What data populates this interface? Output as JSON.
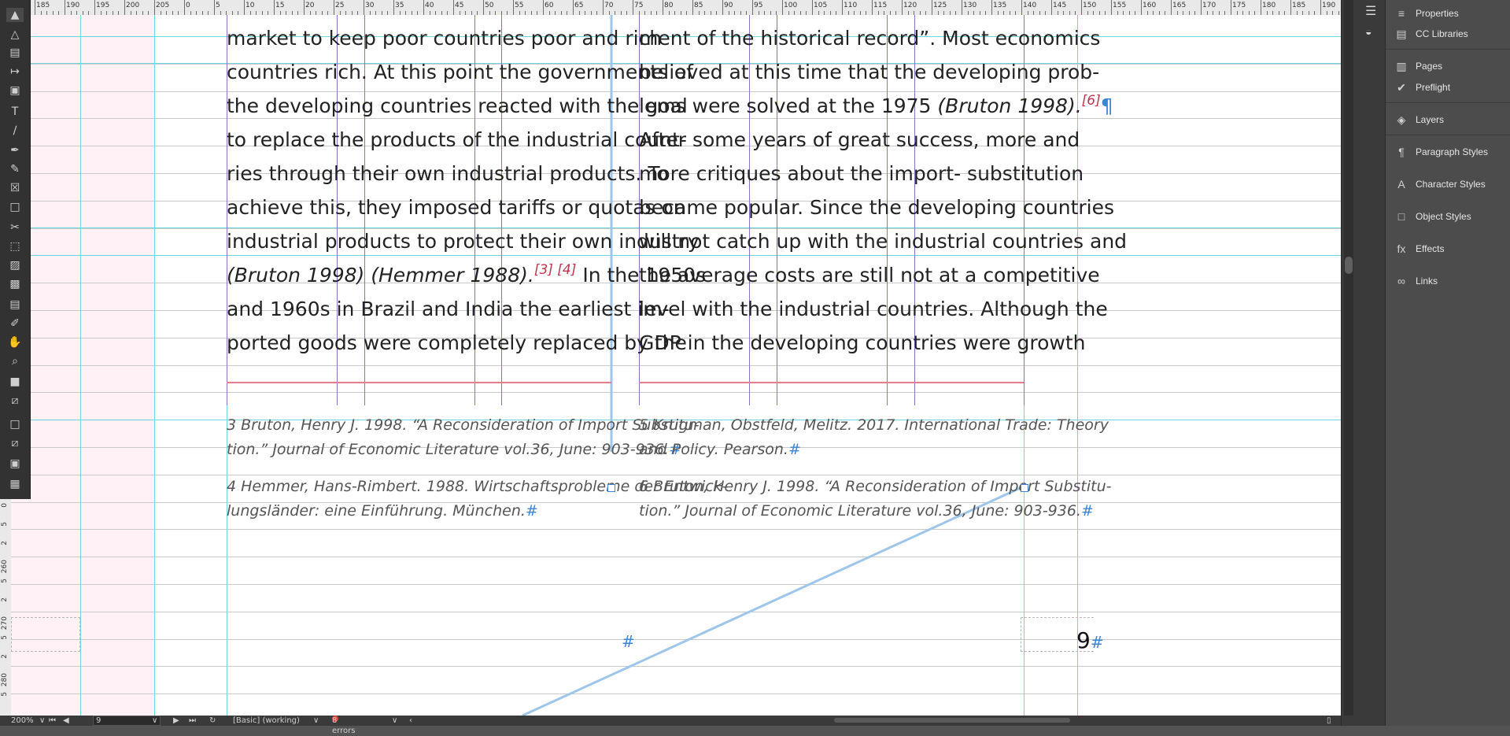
{
  "ruler": {
    "top_labels": [
      "185",
      "190",
      "195",
      "200",
      "205",
      "0",
      "5",
      "10",
      "15",
      "20",
      "25",
      "30",
      "35",
      "40",
      "45",
      "50",
      "55",
      "60",
      "65",
      "70",
      "75",
      "80",
      "85",
      "90",
      "95",
      "100",
      "105",
      "110",
      "115",
      "120",
      "125",
      "130",
      "135",
      "140",
      "145",
      "150",
      "155",
      "160",
      "165",
      "170",
      "175",
      "180",
      "185",
      "190"
    ],
    "left_labels": [
      "0",
      "5",
      "2",
      "260",
      "5",
      "2",
      "270",
      "5",
      "2",
      "280",
      "5"
    ]
  },
  "document": {
    "col1_lines": [
      "market to keep poor countries poor and rich",
      "countries rich. At this point the governments of",
      "the developing countries reacted with the goal",
      "to replace the products of the industrial count-",
      "ries through their own industrial products. To",
      "achieve this, they imposed tariffs or quotas on",
      "industrial products to protect their own industry"
    ],
    "col1_line8_a": "(Bruton 1998) (Hemmer 1988).",
    "col1_line8_ref": "[3] [4]",
    "col1_line8_b": " In the 1950s",
    "col1_line9": "and 1960s in Brazil and India the earliest im-",
    "col1_line10": "ported goods were completely replaced by the",
    "col2_line1": "ment of the historical record”. Most economics",
    "col2_line2": "believed at this time that the developing prob-",
    "col2_line3_a": "lems were solved at the 1975 ",
    "col2_line3_it": "(Bruton 1998).",
    "col2_line3_ref": "[6]",
    "col2_line3_pil": "¶",
    "col2_lines_rest": [
      "After some years of great success, more and",
      "more critiques about the import- substitution",
      "became popular. Since the developing countries",
      "will not catch up with the industrial countries and",
      "the average costs are still not at a competitive",
      "level with the industrial countries. Although the",
      "GDP in the developing countries were growth"
    ],
    "footnotes": {
      "fn3_l1": "3 Bruton, Henry J. 1998. “A Reconsideration of Import Substitu-",
      "fn3_l2": "tion.” Journal of Economic Literature vol.36, June: 903-936.",
      "fn4_l1": "4 Hemmer, Hans-Rimbert. 1988. Wirtschaftsprobleme der Entwick-",
      "fn4_l2": "lungsländer: eine Einführung. München.",
      "fn5_l1": "5 Krugman, Obstfeld, Melitz. 2017. International Trade: Theory",
      "fn5_l2": "and Policy. Pearson.",
      "fn6_l1": "6 Bruton, Henry J. 1998. “A Reconsideration of Import Substitu-",
      "fn6_l2": "tion.” Journal of Economic Literature vol.36, June: 903-936."
    },
    "hash_mark": "#",
    "page_number": "9"
  },
  "panel": {
    "items": [
      {
        "label": "Properties",
        "icon": "properties-icon"
      },
      {
        "label": "CC Libraries",
        "icon": "cc-libraries-icon"
      },
      {
        "label": "Pages",
        "icon": "pages-icon"
      },
      {
        "label": "Preflight",
        "icon": "preflight-icon"
      },
      {
        "label": "Layers",
        "icon": "layers-icon"
      },
      {
        "label": "Paragraph Styles",
        "icon": "paragraph-styles-icon"
      },
      {
        "label": "Character Styles",
        "icon": "character-styles-icon"
      },
      {
        "label": "Object Styles",
        "icon": "object-styles-icon"
      },
      {
        "label": "Effects",
        "icon": "effects-icon"
      },
      {
        "label": "Links",
        "icon": "links-icon"
      }
    ]
  },
  "status": {
    "zoom": "200%",
    "page": "9",
    "profile": "[Basic] (working)",
    "errors": "8 errors"
  },
  "colors": {
    "guide": "#6fd6e1",
    "column_guide": "#8e6fc8",
    "footnote_rule": "#e87d8e",
    "ref_red": "#c0364b",
    "hidden_char_blue": "#3b84d6"
  }
}
